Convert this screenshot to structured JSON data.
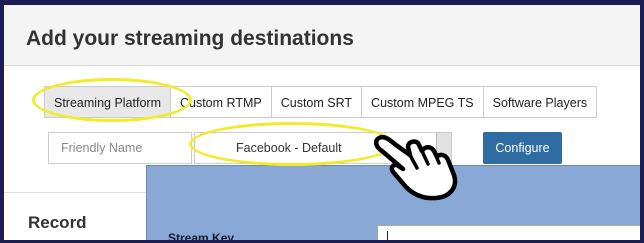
{
  "header": {
    "title": "Add your streaming destinations"
  },
  "tabs": [
    {
      "label": "Streaming Platform",
      "active": true
    },
    {
      "label": "Custom RTMP"
    },
    {
      "label": "Custom SRT"
    },
    {
      "label": "Custom MPEG TS"
    },
    {
      "label": "Software Players"
    }
  ],
  "form": {
    "friendly_name_placeholder": "Friendly Name",
    "platform_value": "Facebook - Default",
    "configure_label": "Configure"
  },
  "record": {
    "title": "Record"
  },
  "modal": {
    "stream_key_label": "Stream Key",
    "stream_key_value": ""
  },
  "colors": {
    "accent": "#2f6ca2",
    "highlight": "#f2ea2c",
    "modal_bg": "#8aa8d5",
    "frame_bg": "#1c1d52"
  },
  "icons": {
    "pointer": "pointing-hand-cursor-icon"
  }
}
